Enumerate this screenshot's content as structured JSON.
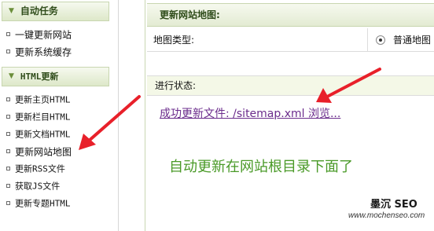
{
  "sidebar": {
    "sections": [
      {
        "title": "自动任务",
        "items": [
          {
            "label": "一键更新网站"
          },
          {
            "label": "更新系统缓存"
          }
        ]
      },
      {
        "title": "HTML更新",
        "items": [
          {
            "label": "更新主页HTML"
          },
          {
            "label": "更新栏目HTML"
          },
          {
            "label": "更新文档HTML"
          },
          {
            "label": "更新网站地图"
          },
          {
            "label": "更新RSS文件"
          },
          {
            "label": "获取JS文件"
          },
          {
            "label": "更新专题HTML"
          }
        ]
      }
    ]
  },
  "main": {
    "title": "更新网站地图:",
    "map_type_label": "地图类型:",
    "map_type_option": "普通地图",
    "status_label": "进行状态:",
    "status_link": "成功更新文件: /sitemap.xml 浏览...",
    "annotation": "自动更新在网站根目录下面了"
  },
  "watermark": {
    "title": "墨沉 SEO",
    "url": "www.mochenseo.com"
  },
  "colors": {
    "header_green": "#2f4c1a",
    "annotation_green": "#4a9a28",
    "link_purple": "#6b2c8c",
    "arrow_red": "#e8202a"
  }
}
